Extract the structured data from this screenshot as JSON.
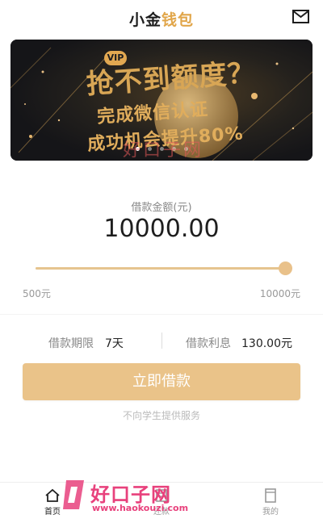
{
  "header": {
    "title_part1": "小金",
    "title_part2": "钱包"
  },
  "banner": {
    "badge": "VIP",
    "headline": "抢不到额度？",
    "line1": "完成微信认证",
    "line2": "成功机会提升80%",
    "dots_count": 5,
    "active_dot": 0,
    "overlay_watermark": "好口子网"
  },
  "loan": {
    "amount_label": "借款金额(元)",
    "amount_value": "10000.00",
    "slider_fraction": 1.0,
    "min_label": "500元",
    "max_label": "10000元",
    "term_label": "借款期限",
    "term_value": "7天",
    "interest_label": "借款利息",
    "interest_value": "130.00元",
    "button_label": "立即借款",
    "notice": "不向学生提供服务"
  },
  "tabbar": {
    "items": [
      {
        "label": "首页",
        "icon": "home-icon",
        "active": true
      },
      {
        "label": "还款",
        "icon": "repay-icon",
        "active": false
      },
      {
        "label": "我的",
        "icon": "profile-icon",
        "active": false
      }
    ]
  },
  "watermark": {
    "brand": "好口子网",
    "url": "www.haokouzi.com"
  },
  "colors": {
    "accent": "#eac389",
    "text_dark": "#1e1e1e",
    "muted": "#888888",
    "watermark": "#e8417c"
  }
}
